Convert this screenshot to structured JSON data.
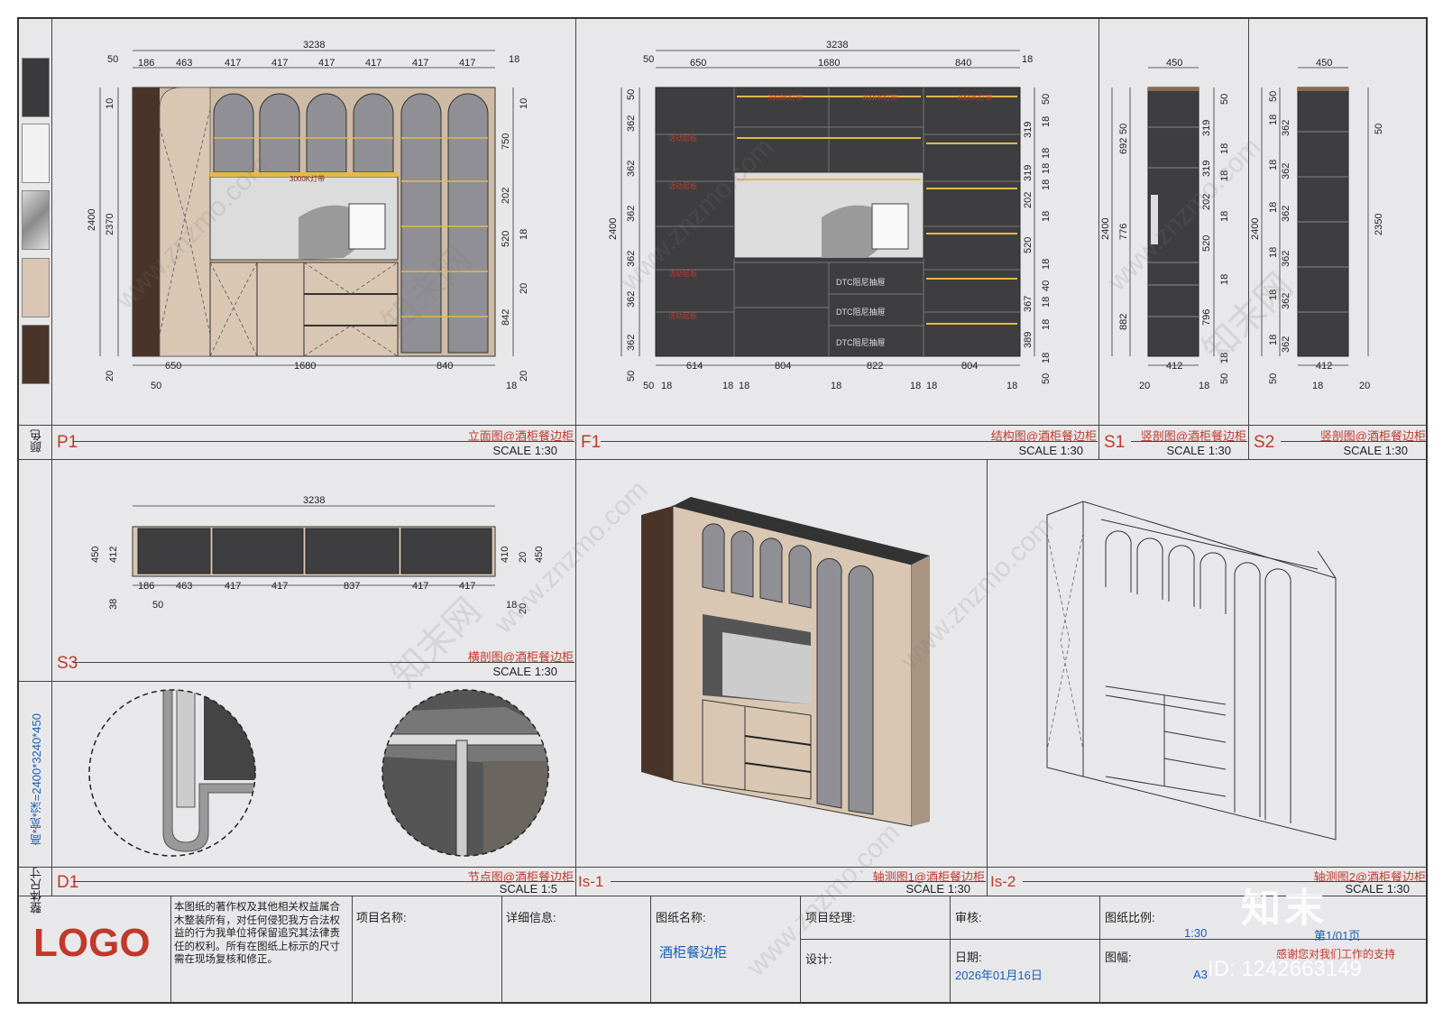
{
  "panels": {
    "p1": {
      "code": "P1",
      "title": "立面图@酒柜餐边柜",
      "scale": "SCALE 1:30"
    },
    "f1": {
      "code": "F1",
      "title": "结构图@酒柜餐边柜",
      "scale": "SCALE 1:30"
    },
    "s1": {
      "code": "S1",
      "title": "竖剖图@酒柜餐边柜",
      "scale": "SCALE 1:30"
    },
    "s2": {
      "code": "S2",
      "title": "竖剖图@酒柜餐边柜",
      "scale": "SCALE 1:30"
    },
    "s3": {
      "code": "S3",
      "title": "横剖图@酒柜餐边柜",
      "scale": "SCALE 1:30"
    },
    "d1": {
      "code": "D1",
      "title": "节点图@酒柜餐边柜",
      "scale": "SCALE 1:5"
    },
    "is1": {
      "code": "Is-1",
      "title": "轴测图1@酒柜餐边柜",
      "scale": "SCALE 1:30"
    },
    "is2": {
      "code": "Is-2",
      "title": "轴测图2@酒柜餐边柜",
      "scale": "SCALE 1:30"
    }
  },
  "sidebar": {
    "color_label": "颜色",
    "overall_label": "整体尺寸",
    "overall_value": "高*宽*深=2400*3240*450",
    "swatches": [
      "#3a3a3c",
      "#f2f2f2",
      "#b8b8b8",
      "#d9c7b3",
      "#4a3428"
    ]
  },
  "dims": {
    "p1": {
      "total": "3238",
      "left": "50",
      "right": "18",
      "top": [
        "186",
        "463",
        "417",
        "417",
        "417",
        "417",
        "417",
        "417"
      ],
      "bottom": [
        "650",
        "1680",
        "840"
      ],
      "bottom_left": "50",
      "bottom_right": "18",
      "left_v": [
        "2400",
        "2370",
        "10",
        "20"
      ],
      "right_v": [
        "10",
        "750",
        "202",
        "520",
        "18",
        "20",
        "842",
        "20"
      ]
    },
    "f1": {
      "total": "3238",
      "left": "50",
      "right": "18",
      "top": [
        "650",
        "1680",
        "840"
      ],
      "bottom": [
        "614",
        "804",
        "822",
        "804"
      ],
      "bottom_small": [
        "50",
        "18",
        "18",
        "18",
        "18",
        "18",
        "18",
        "18"
      ],
      "left_v": [
        "2400",
        "362",
        "362",
        "362",
        "362",
        "362",
        "362",
        "50",
        "50"
      ],
      "right_v": [
        "50",
        "18",
        "319",
        "18",
        "319",
        "18",
        "18",
        "202",
        "18",
        "520",
        "18",
        "40",
        "18",
        "367",
        "18",
        "389",
        "18",
        "50"
      ]
    },
    "s1": {
      "top": "450",
      "bottom": "412",
      "bottom_small": [
        "20",
        "18"
      ],
      "left_v": [
        "2400",
        "50",
        "692",
        "776",
        "882"
      ],
      "right_v": [
        "50",
        "319",
        "18",
        "319",
        "18",
        "202",
        "18",
        "520",
        "18",
        "796",
        "18",
        "50"
      ]
    },
    "s2": {
      "top": "450",
      "bottom": "412",
      "bottom_small": [
        "18",
        "20"
      ],
      "left_v": [
        "2400",
        "50",
        "362",
        "18",
        "362",
        "18",
        "362",
        "18",
        "362",
        "18",
        "362",
        "18",
        "362",
        "18",
        "50"
      ],
      "right_v": [
        "50",
        "2350"
      ]
    },
    "s3": {
      "total": "3238",
      "bottom": [
        "186",
        "463",
        "417",
        "417",
        "837",
        "417",
        "417"
      ],
      "bottom_small": [
        "50",
        "18"
      ],
      "left_v": [
        "450",
        "412",
        "38"
      ],
      "right_v": [
        "410",
        "20",
        "450",
        "20"
      ]
    }
  },
  "labels": {
    "light": "3000K灯带",
    "drawer": "DTC阻尼抽屉",
    "shelf": "活动层板"
  },
  "title_block": {
    "logo": "LOGO",
    "copyright": "本图纸的著作权及其他相关权益属合木整装所有，对任何侵犯我方合法权益的行为我单位将保留追究其法律责任的权利。所有在图纸上标示的尺寸需在现场复核和修正。",
    "project_name_label": "项目名称:",
    "detail_label": "详细信息:",
    "drawing_name_label": "图纸名称:",
    "drawing_name_value": "酒柜餐边柜",
    "manager_label": "项目经理:",
    "design_label": "设计:",
    "review_label": "审核:",
    "date_label": "日期:",
    "date_value": "2026年01月16日",
    "scale_label": "图纸比例:",
    "scale_value": "1:30",
    "page_value": "第1/01页",
    "size_label": "图幅:",
    "size_value": "A3",
    "thanks": "感谢您对我们工作的支持"
  },
  "watermark": {
    "site": "www.znzmo.com",
    "brand": "知末网",
    "brand_short": "知末",
    "id": "ID: 1242663149"
  }
}
